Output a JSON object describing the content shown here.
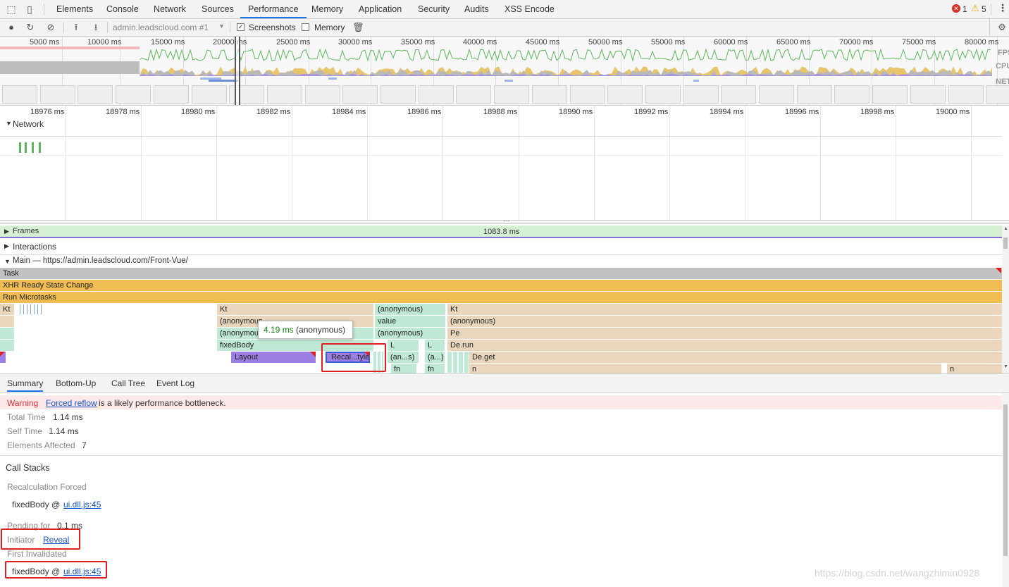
{
  "tabbar": {
    "tabs": [
      "Elements",
      "Console",
      "Network",
      "Sources",
      "Performance",
      "Memory",
      "Application",
      "Security",
      "Audits",
      "XSS Encode"
    ],
    "active_tab": "Performance",
    "errors": "1",
    "warnings": "5"
  },
  "toolbar": {
    "target": "admin.leadscloud.com #1",
    "screenshots_label": "Screenshots",
    "screenshots_checked": true,
    "memory_label": "Memory",
    "memory_checked": false
  },
  "overview": {
    "ticks": [
      "5000 ms",
      "10000 ms",
      "15000 ms",
      "20000 ms",
      "25000 ms",
      "30000 ms",
      "35000 ms",
      "40000 ms",
      "45000 ms",
      "50000 ms",
      "55000 ms",
      "60000 ms",
      "65000 ms",
      "70000 ms",
      "75000 ms",
      "80000 ms"
    ],
    "lanes": [
      "FPS",
      "CPU",
      "NET"
    ]
  },
  "ruler": {
    "ticks": [
      "18976 ms",
      "18978 ms",
      "18980 ms",
      "18982 ms",
      "18984 ms",
      "18986 ms",
      "18988 ms",
      "18990 ms",
      "18992 ms",
      "18994 ms",
      "18996 ms",
      "18998 ms",
      "19000 ms"
    ]
  },
  "tracks": {
    "network_label": "Network",
    "frames_label": "Frames",
    "frames_duration": "1083.8 ms",
    "interactions_label": "Interactions",
    "main_label": "Main — https://admin.leadscloud.com/Front-Vue/"
  },
  "flame": {
    "task": "Task",
    "xhr": "XHR Ready State Change",
    "microtasks": "Run Microtasks",
    "kt_left": "Kt",
    "kt_mid": "Kt",
    "anon_1": "(anonymous",
    "anon_2": "(anonymous",
    "fixed_body": "fixedBody",
    "layout": "Layout",
    "recalc": "Recal...tyle",
    "anon_c1": "(anonymous)",
    "value": "value",
    "anon_c3": "(anonymous)",
    "l1": "L",
    "l2": "L",
    "ans": "(an...s)",
    "a_dots": "(a...)",
    "fn1": "fn",
    "fn2": "fn",
    "kt_right": "Kt",
    "anon_r": "(anonymous)",
    "pe": "Pe",
    "derun": "De.run",
    "deget": "De.get",
    "n1": "n",
    "n2": "n",
    "tooltip_time": "4.19 ms",
    "tooltip_name": "(anonymous)"
  },
  "bottom": {
    "tabs": [
      "Summary",
      "Bottom-Up",
      "Call Tree",
      "Event Log"
    ],
    "warning_label": "Warning",
    "warning_link": "Forced reflow",
    "warning_text": "is a likely performance bottleneck.",
    "total_time_label": "Total Time",
    "total_time": "1.14 ms",
    "self_time_label": "Self Time",
    "self_time": "1.14 ms",
    "elements_label": "Elements Affected",
    "elements": "7",
    "call_stacks": "Call Stacks",
    "recalc_forced": "Recalculation Forced",
    "stack1_fn": "fixedBody @",
    "stack1_link": "ui.dll.js:45",
    "pending_label": "Pending for",
    "pending": "0.1 ms",
    "initiator_label": "Initiator",
    "initiator_link": "Reveal",
    "first_invalidated": "First Invalidated",
    "stack2_fn": "fixedBody @",
    "stack2_link": "ui.dll.js:45"
  },
  "watermark": "https://blog.csdn.net/wangzhimin0928",
  "colors": {
    "task": "#c2c2c2",
    "xhr": "#efbd52",
    "js_tan": "#e9d6bd",
    "js_green": "#bfe9d5",
    "layout": "#9b7fe3",
    "warning_bg": "#fde8ea",
    "accent": "#1a73e8"
  }
}
